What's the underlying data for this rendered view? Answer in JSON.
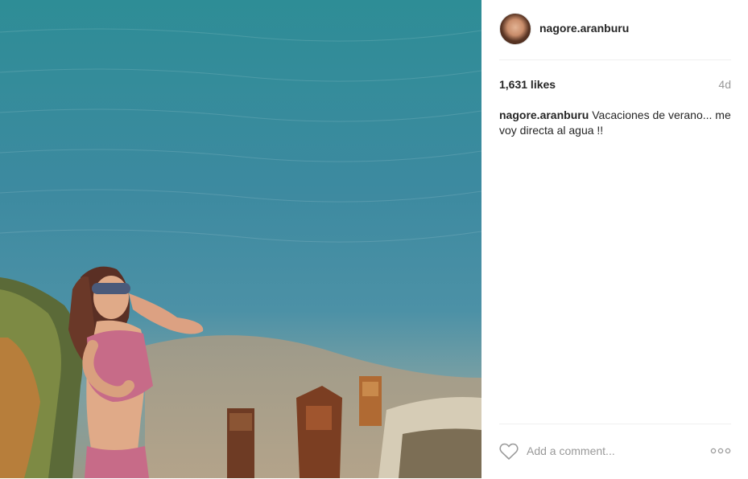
{
  "post": {
    "username": "nagore.aranburu",
    "likes": "1,631 likes",
    "time_ago": "4d",
    "caption_user": "nagore.aranburu",
    "caption_text": "Vacaciones de verano... me voy directa al agua !!"
  },
  "actions": {
    "comment_placeholder": "Add a comment...",
    "like_icon": "heart-outline-icon",
    "more_icon": "more-options-icon"
  },
  "photo": {
    "description_icon": "photo"
  }
}
